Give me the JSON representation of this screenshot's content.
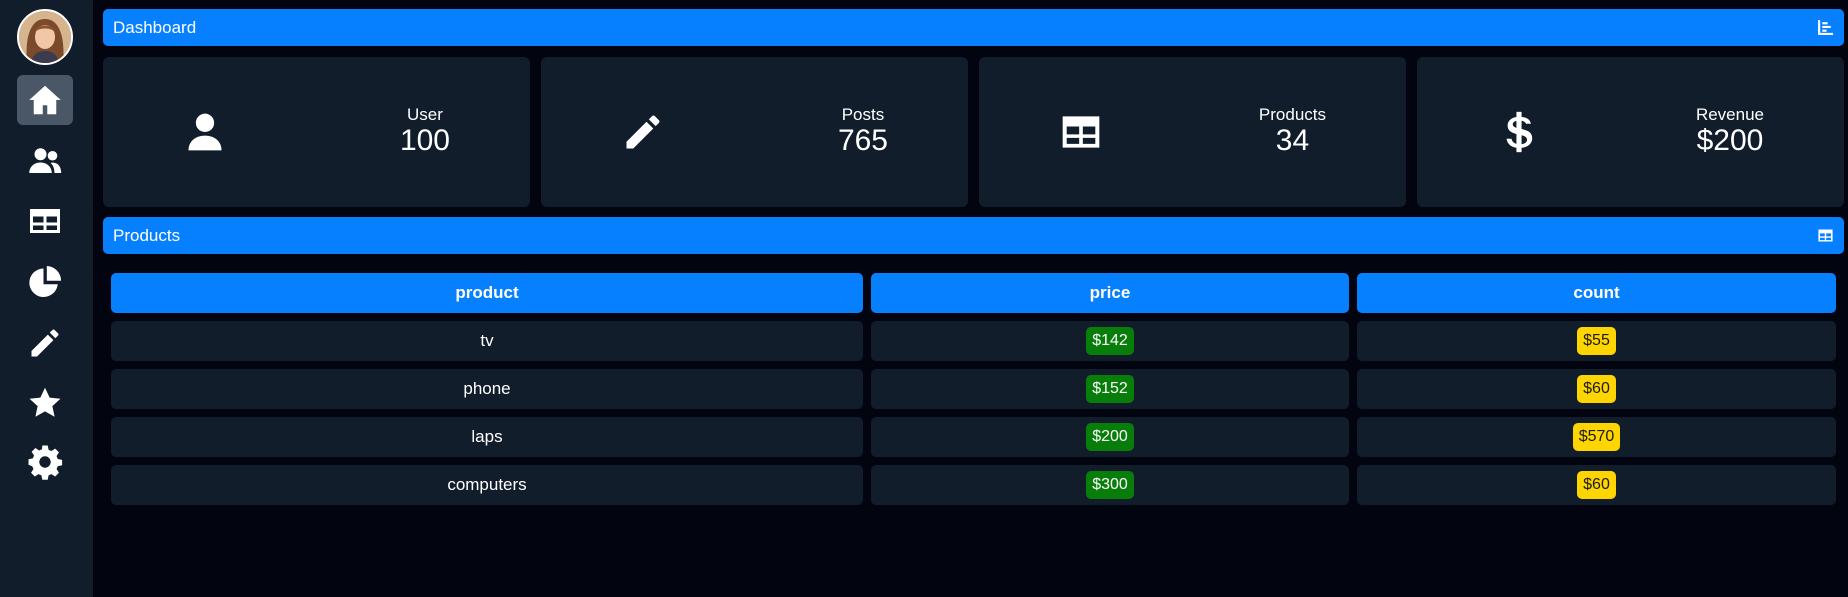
{
  "colors": {
    "accent": "#0780ff",
    "panel": "#111d2b",
    "background": "#02040f",
    "price_badge": "#087e0a",
    "count_badge": "#ffd500"
  },
  "sidebar": {
    "avatar": "user-avatar",
    "items": [
      {
        "icon": "home-icon",
        "active": true
      },
      {
        "icon": "users-icon",
        "active": false
      },
      {
        "icon": "table-icon",
        "active": false
      },
      {
        "icon": "pie-chart-icon",
        "active": false
      },
      {
        "icon": "pencil-icon",
        "active": false
      },
      {
        "icon": "star-icon",
        "active": false
      },
      {
        "icon": "gear-icon",
        "active": false
      }
    ]
  },
  "dashboard_bar": {
    "title": "Dashboard",
    "icon": "bar-chart-icon"
  },
  "cards": [
    {
      "label": "User",
      "value": "100",
      "icon": "user-icon"
    },
    {
      "label": "Posts",
      "value": "765",
      "icon": "pencil-icon"
    },
    {
      "label": "Products",
      "value": "34",
      "icon": "table-icon"
    },
    {
      "label": "Revenue",
      "value": "$200",
      "icon": "dollar-icon"
    }
  ],
  "products_bar": {
    "title": "Products",
    "icon": "table-icon"
  },
  "table": {
    "headers": [
      "product",
      "price",
      "count"
    ],
    "rows": [
      {
        "product": "tv",
        "price": "$142",
        "count": "$55"
      },
      {
        "product": "phone",
        "price": "$152",
        "count": "$60"
      },
      {
        "product": "laps",
        "price": "$200",
        "count": "$570"
      },
      {
        "product": "computers",
        "price": "$300",
        "count": "$60"
      }
    ]
  }
}
